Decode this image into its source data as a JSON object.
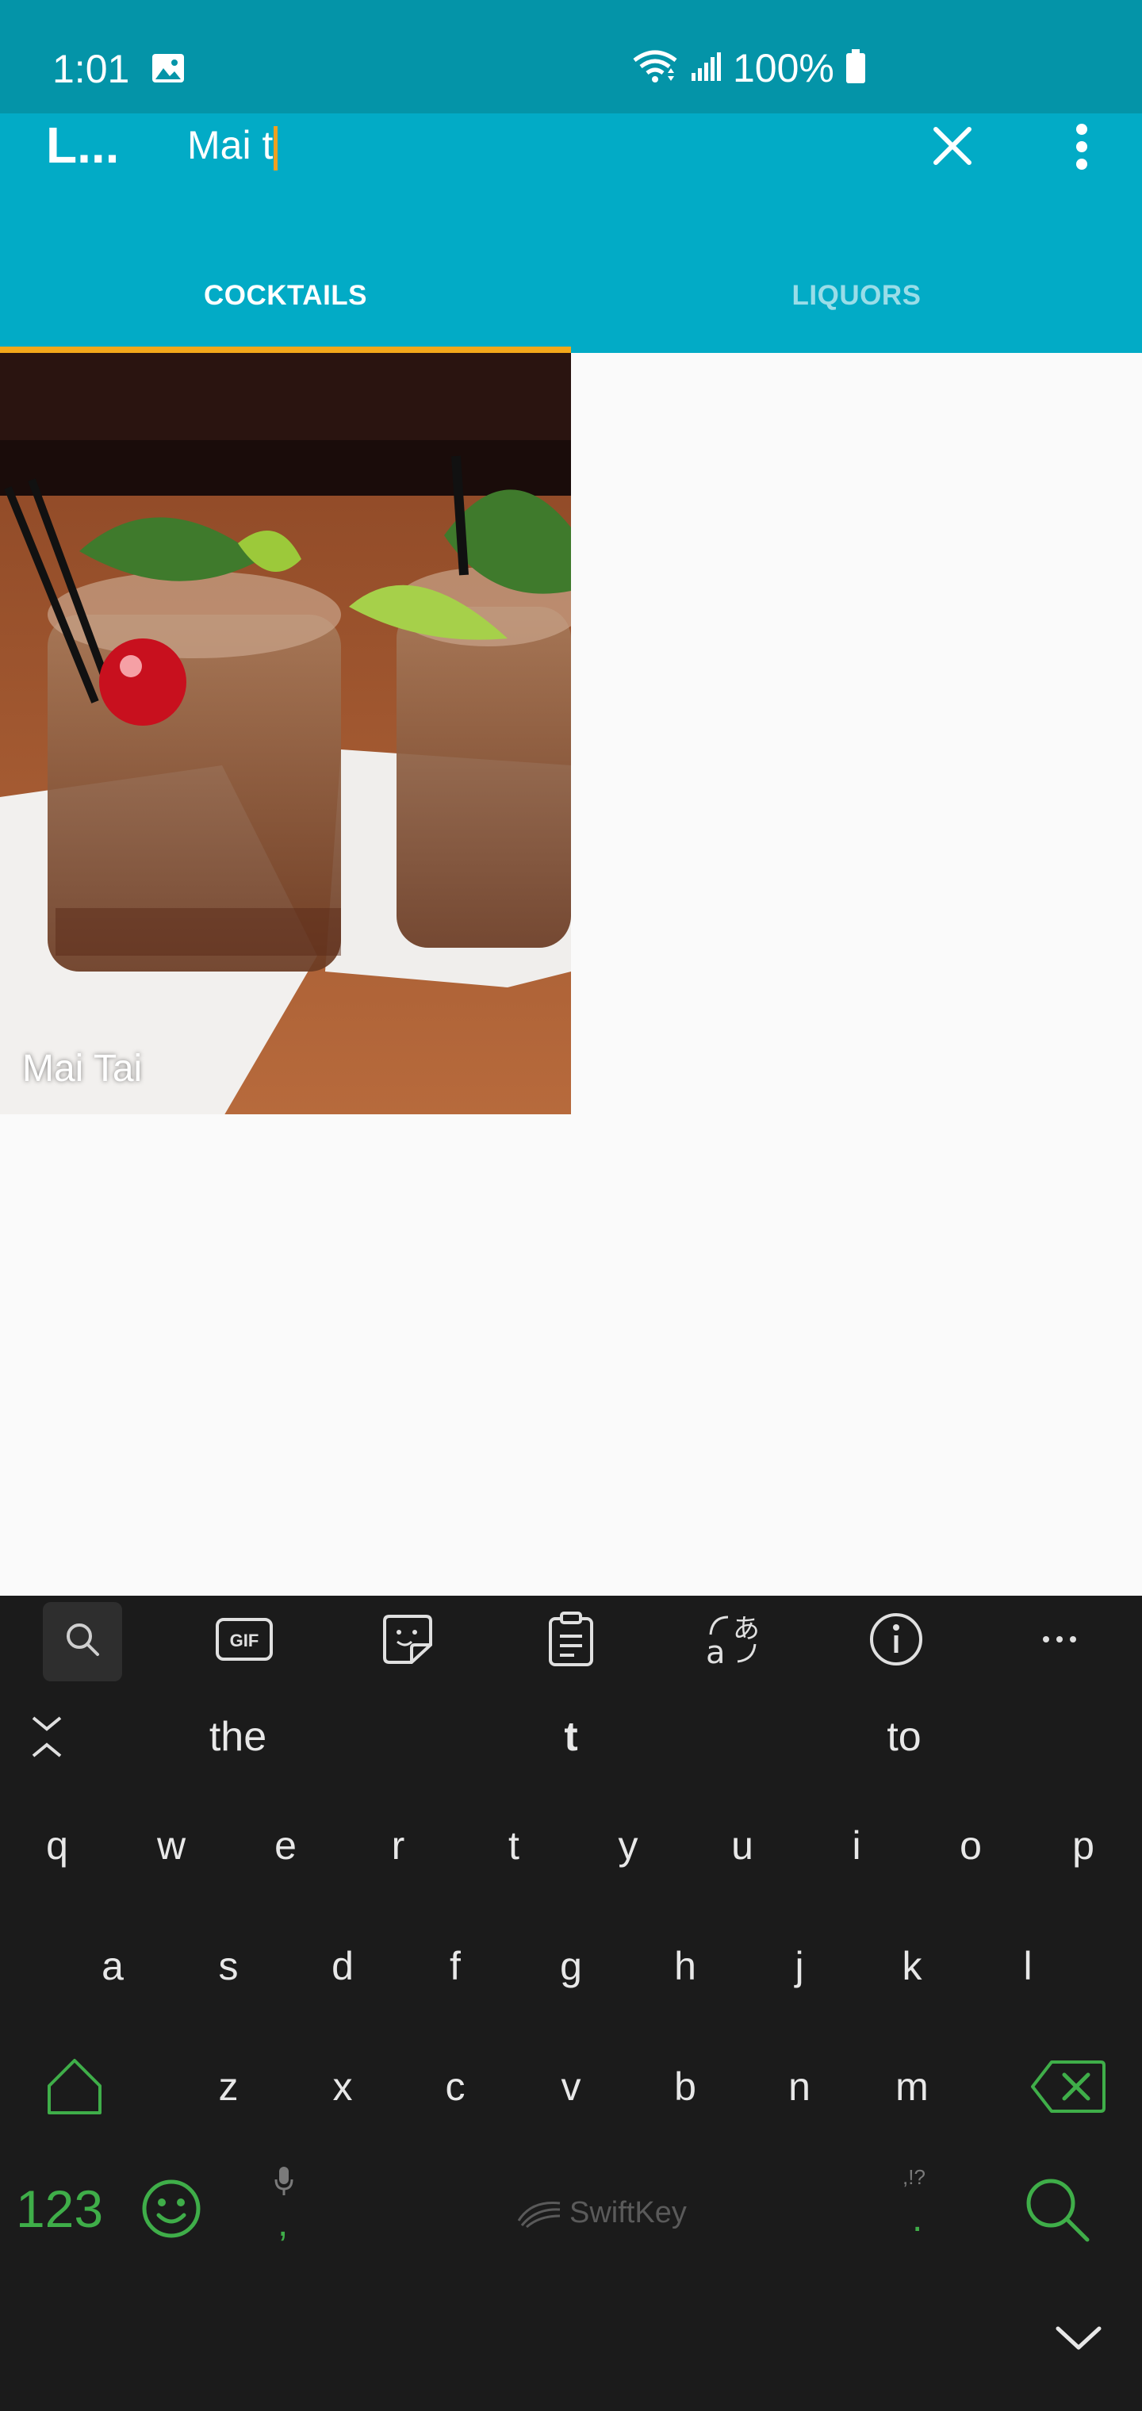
{
  "status_bar": {
    "time": "1:01",
    "battery": "100%",
    "icons": [
      "gallery-icon",
      "wifi-icon",
      "signal-icon",
      "battery-icon"
    ]
  },
  "app_bar": {
    "title": "L...",
    "search_value": "Mai t",
    "close_icon": "close-icon",
    "more_icon": "more-vert-icon"
  },
  "tabs": [
    {
      "label": "COCKTAILS",
      "selected": true
    },
    {
      "label": "LIQUORS",
      "selected": false
    }
  ],
  "results": [
    {
      "name": "Mai Tai"
    }
  ],
  "keyboard": {
    "toolbar": [
      "search-icon",
      "gif-icon",
      "sticker-icon",
      "clipboard-icon",
      "translate-icon",
      "info-icon",
      "more-icon"
    ],
    "suggestions": [
      "the",
      "t",
      "to"
    ],
    "row1": [
      "q",
      "w",
      "e",
      "r",
      "t",
      "y",
      "u",
      "i",
      "o",
      "p"
    ],
    "row2": [
      "a",
      "s",
      "d",
      "f",
      "g",
      "h",
      "j",
      "k",
      "l"
    ],
    "row3": [
      "z",
      "x",
      "c",
      "v",
      "b",
      "n",
      "m"
    ],
    "numbers_key": "123",
    "comma": ",",
    "period": ".",
    "punct_hint": ",!?",
    "brand": "SwiftKey",
    "accent_color": "#3fae49"
  },
  "colors": {
    "status_bar": "#0494a8",
    "app_bar": "#02abc6",
    "tab_indicator": "#f3a71a"
  }
}
